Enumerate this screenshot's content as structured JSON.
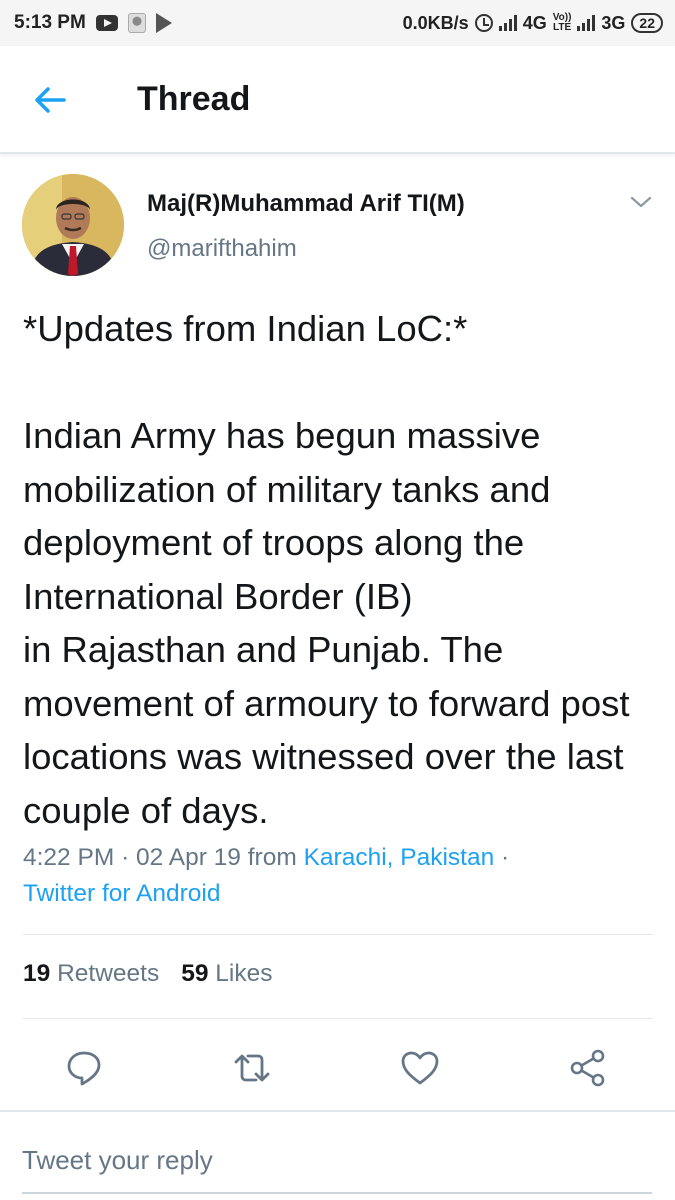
{
  "status_bar": {
    "time": "5:13 PM",
    "net_speed": "0.0KB/s",
    "network_1": "4G",
    "network_2": "3G",
    "volte_line1": "Vo))",
    "volte_line2": "LTE",
    "battery": "22",
    "icons": [
      "youtube-icon",
      "emblem-icon",
      "play-store-icon",
      "alarm-icon",
      "signal-icon",
      "signal-icon"
    ]
  },
  "header": {
    "title": "Thread",
    "back_icon": "arrow-left-icon"
  },
  "tweet": {
    "author_name": "Maj(R)Muhammad Arif TI(M)",
    "author_handle": "@marifthahim",
    "text": "*Updates from Indian LoC:*\n\nIndian Army has begun massive mobilization of military tanks and deployment of troops along the International Border (IB)\nin Rajasthan and Punjab. The movement of armoury to forward post locations was witnessed over the last couple of days.",
    "time": "4:22 PM",
    "date": "02 Apr 19",
    "from_label": "from",
    "location": "Karachi, Pakistan",
    "separator": "·",
    "source": "Twitter for Android",
    "retweets_count": "19",
    "retweets_label": "Retweets",
    "likes_count": "59",
    "likes_label": "Likes"
  },
  "actions": [
    "reply-icon",
    "retweet-icon",
    "like-icon",
    "share-icon"
  ],
  "reply": {
    "placeholder": "Tweet your reply"
  },
  "colors": {
    "accent": "#1da1f2",
    "text": "#14171a",
    "secondary": "#657786",
    "divider": "#e1e8ed"
  }
}
